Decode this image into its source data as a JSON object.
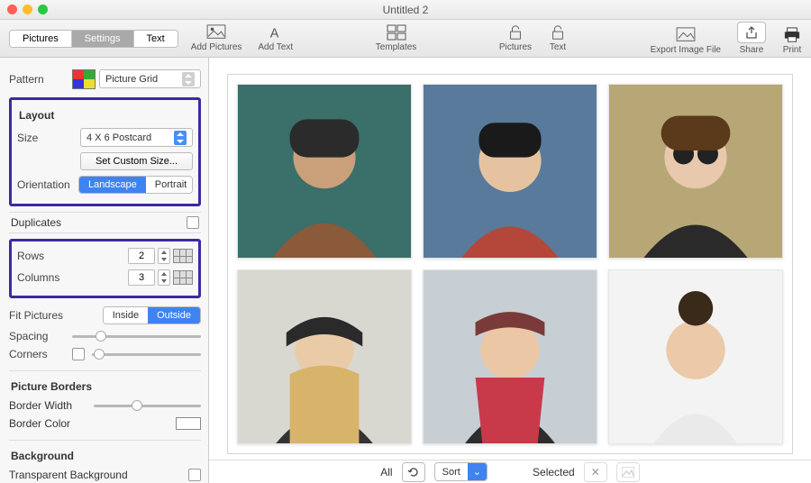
{
  "window": {
    "title": "Untitled 2"
  },
  "tabs": {
    "pictures": "Pictures",
    "settings": "Settings",
    "text": "Text",
    "active": "settings"
  },
  "toolbar": {
    "add_pictures": "Add Pictures",
    "add_text": "Add Text",
    "templates": "Templates",
    "pictures": "Pictures",
    "text": "Text",
    "export": "Export Image File",
    "share": "Share",
    "print": "Print"
  },
  "sidebar": {
    "pattern_label": "Pattern",
    "pattern_value": "Picture Grid",
    "layout": {
      "heading": "Layout",
      "size_label": "Size",
      "size_value": "4 X 6 Postcard",
      "custom_btn": "Set Custom Size...",
      "orientation_label": "Orientation",
      "orientation_landscape": "Landscape",
      "orientation_portrait": "Portrait"
    },
    "duplicates_label": "Duplicates",
    "rows_label": "Rows",
    "rows_value": "2",
    "columns_label": "Columns",
    "columns_value": "3",
    "fit_label": "Fit Pictures",
    "fit_inside": "Inside",
    "fit_outside": "Outside",
    "spacing_label": "Spacing",
    "corners_label": "Corners",
    "borders_heading": "Picture Borders",
    "border_width_label": "Border Width",
    "border_color_label": "Border Color",
    "background_heading": "Background",
    "transparent_bg_label": "Transparent Background"
  },
  "bottom": {
    "all": "All",
    "sort": "Sort",
    "selected": "Selected"
  },
  "grid": {
    "rows": 2,
    "cols": 3
  }
}
